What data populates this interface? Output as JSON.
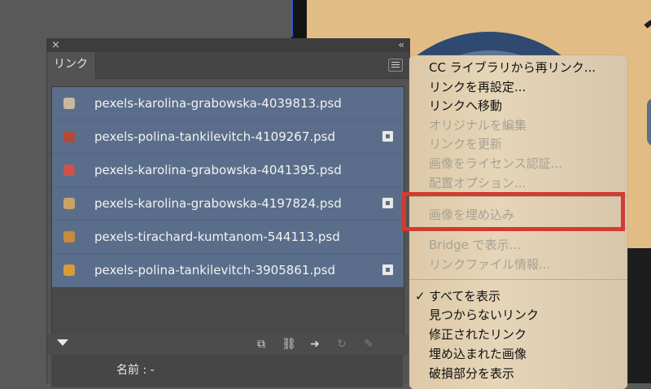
{
  "panel": {
    "tab_label": "リンク",
    "close_glyph": "×",
    "collapse_glyph": "‹‹"
  },
  "links": [
    {
      "name": "pexels-karolina-grabowska-4039813.psd",
      "thumb_color": "#c9b8a0",
      "embedded_badge": false
    },
    {
      "name": "pexels-polina-tankilevitch-4109267.psd",
      "thumb_color": "#b24a3a",
      "embedded_badge": true
    },
    {
      "name": "pexels-karolina-grabowska-4041395.psd",
      "thumb_color": "#c8544c",
      "embedded_badge": false
    },
    {
      "name": "pexels-karolina-grabowska-4197824.psd",
      "thumb_color": "#caa268",
      "embedded_badge": true
    },
    {
      "name": "pexels-tirachard-kumtanom-544113.psd",
      "thumb_color": "#c98a3c",
      "embedded_badge": false
    },
    {
      "name": "pexels-polina-tankilevitch-3905861.psd",
      "thumb_color": "#d99a3a",
      "embedded_badge": true
    }
  ],
  "info": {
    "name_label": "名前 :  -"
  },
  "menu": {
    "items": [
      {
        "label": "CC ライブラリから再リンク...",
        "enabled": true
      },
      {
        "label": "リンクを再設定...",
        "enabled": true
      },
      {
        "label": "リンクへ移動",
        "enabled": true
      },
      {
        "label": "オリジナルを編集",
        "enabled": false
      },
      {
        "label": "リンクを更新",
        "enabled": false
      },
      {
        "label": "画像をライセンス認証...",
        "enabled": false
      },
      {
        "label": "配置オプション...",
        "enabled": false
      },
      {
        "label": "画像を埋め込み",
        "enabled": false
      },
      {
        "label": "Bridge で表示...",
        "enabled": false
      },
      {
        "label": "リンクファイル情報...",
        "enabled": false
      },
      {
        "label": "すべてを表示",
        "enabled": true,
        "checked": true
      },
      {
        "label": "見つからないリンク",
        "enabled": true
      },
      {
        "label": "修正されたリンク",
        "enabled": true
      },
      {
        "label": "埋め込まれた画像",
        "enabled": true
      },
      {
        "label": "破損部分を表示",
        "enabled": true
      }
    ],
    "check_glyph": "✓"
  },
  "colors": {
    "highlight": "#d23b2f",
    "selected_row": "#5a6e8b"
  }
}
